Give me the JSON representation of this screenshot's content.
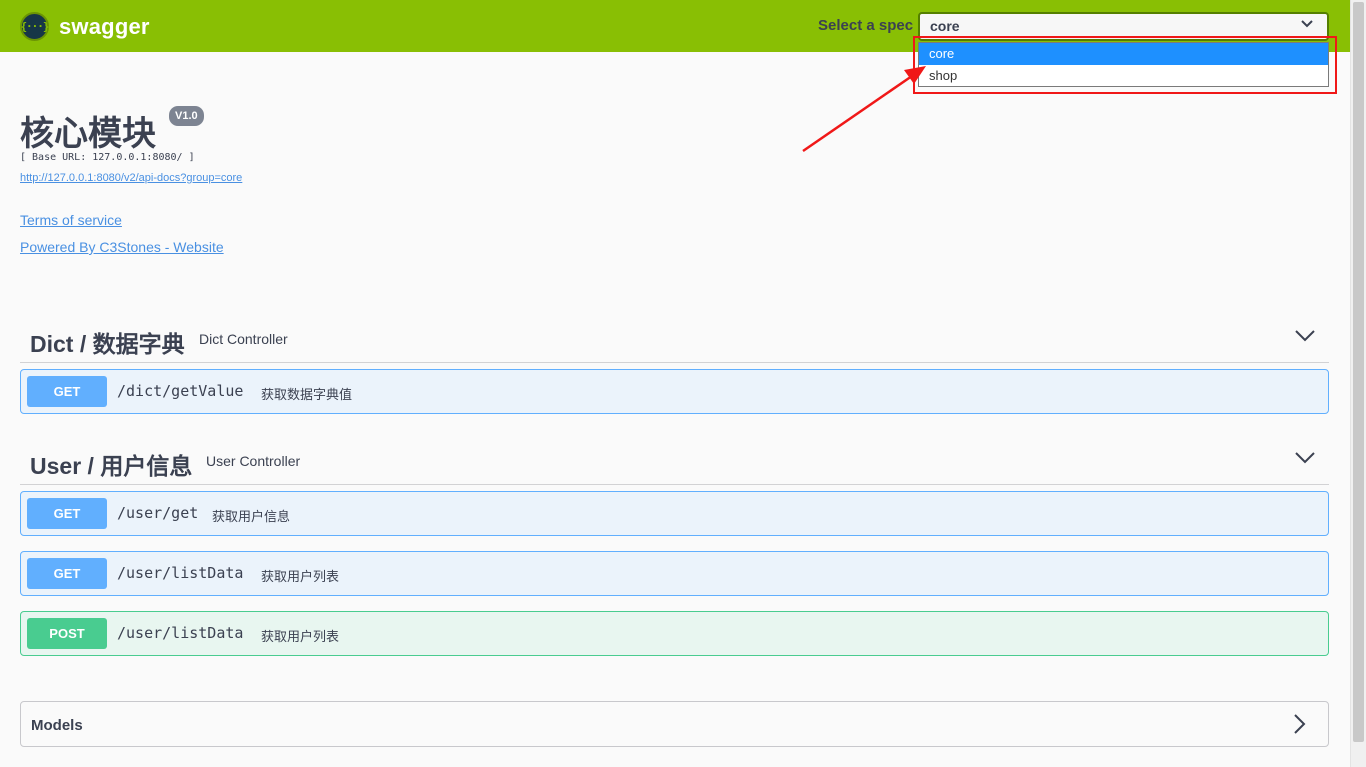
{
  "topbar": {
    "logo_glyph": "{···}",
    "brand": "swagger",
    "spec_label": "Select a spec",
    "spec_value": "core",
    "spec_options": [
      "core",
      "shop"
    ]
  },
  "info": {
    "title": "核心模块",
    "version": "V1.0",
    "base_url": "[ Base URL: 127.0.0.1:8080/ ]",
    "api_docs_link": "http://127.0.0.1:8080/v2/api-docs?group=core",
    "terms": "Terms of service",
    "powered": "Powered By C3Stones - Website"
  },
  "tags": [
    {
      "name": "Dict / 数据字典",
      "description": "Dict Controller",
      "operations": [
        {
          "method": "GET",
          "path": "/dict/getValue",
          "summary": "获取数据字典值"
        }
      ]
    },
    {
      "name": "User / 用户信息",
      "description": "User Controller",
      "operations": [
        {
          "method": "GET",
          "path": "/user/get",
          "summary": "获取用户信息"
        },
        {
          "method": "GET",
          "path": "/user/listData",
          "summary": "获取用户列表"
        },
        {
          "method": "POST",
          "path": "/user/listData",
          "summary": "获取用户列表"
        }
      ]
    }
  ],
  "models": {
    "label": "Models"
  },
  "colors": {
    "topbar": "#89bf04",
    "get": "#61affe",
    "post": "#49cc90",
    "highlight": "#f01818",
    "option_selected": "#1e90ff"
  }
}
